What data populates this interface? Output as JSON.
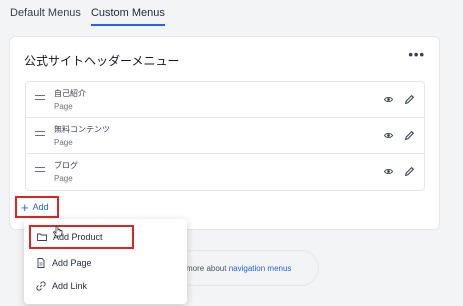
{
  "tabs": [
    {
      "label": "Default Menus",
      "active": false
    },
    {
      "label": "Custom Menus",
      "active": true
    }
  ],
  "card": {
    "title": "公式サイトヘッダーメニュー",
    "more_label": "•••"
  },
  "menu_items": [
    {
      "name": "自己紹介",
      "type": "Page"
    },
    {
      "name": "無料コンテンツ",
      "type": "Page"
    },
    {
      "name": "ブログ",
      "type": "Page"
    }
  ],
  "add_button": {
    "label": "Add",
    "icon": "plus-icon"
  },
  "dropdown": [
    {
      "label": "Add Product",
      "icon": "folder-icon"
    },
    {
      "label": "Add Page",
      "icon": "page-icon"
    },
    {
      "label": "Add Link",
      "icon": "link-icon"
    }
  ],
  "learn_more": {
    "prefix": "more about",
    "link": "navigation menus"
  },
  "colors": {
    "accent": "#2563eb",
    "highlight_border": "#dc2626"
  }
}
